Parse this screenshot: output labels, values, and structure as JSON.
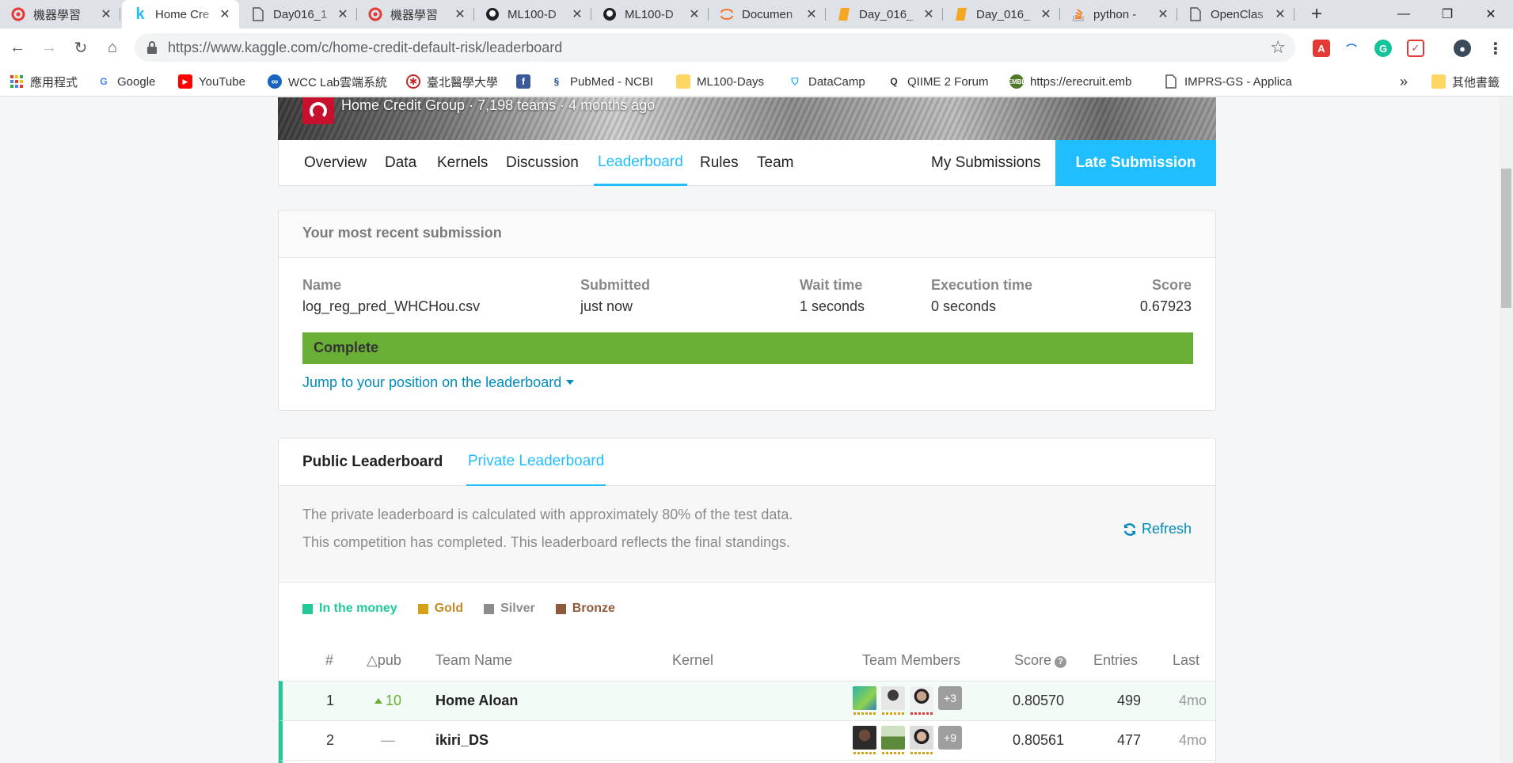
{
  "browser": {
    "tabs": [
      {
        "title": "機器學習",
        "icon": "red-swirl-icon",
        "active": false
      },
      {
        "title": "Home Cre",
        "icon": "kaggle-k-icon",
        "active": true
      },
      {
        "title": "Day016_1",
        "icon": "document-icon",
        "active": false
      },
      {
        "title": "機器學習",
        "icon": "red-swirl-icon",
        "active": false
      },
      {
        "title": "ML100-D",
        "icon": "github-icon",
        "active": false
      },
      {
        "title": "ML100-D",
        "icon": "github-icon",
        "active": false
      },
      {
        "title": "Documen",
        "icon": "jupyter-icon",
        "active": false
      },
      {
        "title": "Day_016_",
        "icon": "orange-book-icon",
        "active": false
      },
      {
        "title": "Day_016_",
        "icon": "orange-book-icon",
        "active": false
      },
      {
        "title": "python -",
        "icon": "stackoverflow-icon",
        "active": false
      },
      {
        "title": "OpenClas",
        "icon": "document-icon",
        "active": false
      }
    ],
    "url_host": "https://www.kaggle.com",
    "url_path": "/c/home-credit-default-risk/leaderboard",
    "bookmarks": [
      {
        "label": "應用程式",
        "icon": "apps-grid-icon"
      },
      {
        "label": "Google",
        "icon": "google-icon"
      },
      {
        "label": "YouTube",
        "icon": "youtube-icon"
      },
      {
        "label": "WCC Lab雲端系統",
        "icon": "cloud-icon"
      },
      {
        "label": "臺北醫學大學",
        "icon": "university-icon"
      },
      {
        "label": "",
        "icon": "facebook-icon"
      },
      {
        "label": "PubMed - NCBI",
        "icon": "pubmed-icon"
      },
      {
        "label": "ML100-Days",
        "icon": "folder-icon"
      },
      {
        "label": "DataCamp",
        "icon": "datacamp-icon"
      },
      {
        "label": "QIIME 2 Forum",
        "icon": "qiime-icon"
      },
      {
        "label": "https://erecruit.emb",
        "icon": "embl-icon"
      },
      {
        "label": "IMPRS-GS - Applica",
        "icon": "document-icon"
      },
      {
        "label": "其他書籤",
        "icon": "folder-icon"
      }
    ],
    "overflow_label": "»"
  },
  "competition": {
    "host": "Home Credit Group",
    "teams": "7,198 teams",
    "ago": "4 months ago",
    "nav": [
      "Overview",
      "Data",
      "Kernels",
      "Discussion",
      "Leaderboard",
      "Rules",
      "Team"
    ],
    "my_submissions": "My Submissions",
    "late_submission": "Late Submission"
  },
  "recent": {
    "header": "Your most recent submission",
    "labels": {
      "name": "Name",
      "submitted": "Submitted",
      "wait": "Wait time",
      "exec": "Execution time",
      "score": "Score"
    },
    "values": {
      "name": "log_reg_pred_WHCHou.csv",
      "submitted": "just now",
      "wait": "1 seconds",
      "exec": "0 seconds",
      "score": "0.67923"
    },
    "status": "Complete",
    "jump": "Jump to your position on the leaderboard"
  },
  "leaderboard": {
    "tabs": [
      "Public Leaderboard",
      "Private Leaderboard"
    ],
    "info1": "The private leaderboard is calculated with approximately 80% of the test data.",
    "info2": "This competition has completed. This leaderboard reflects the final standings.",
    "refresh": "Refresh",
    "legend": [
      {
        "label": "In the money",
        "color": "#20c997"
      },
      {
        "label": "Gold",
        "color": "#d4a017"
      },
      {
        "label": "Silver",
        "color": "#8c8c8c"
      },
      {
        "label": "Bronze",
        "color": "#8d5a3b"
      }
    ],
    "columns": {
      "rank": "#",
      "delta": "△pub",
      "team": "Team Name",
      "kernel": "Kernel",
      "members": "Team Members",
      "score": "Score",
      "help": "?",
      "entries": "Entries",
      "last": "Last"
    },
    "rows": [
      {
        "rank": "1",
        "delta": "10",
        "team": "Home Aloan",
        "more": "+3",
        "score": "0.80570",
        "entries": "499",
        "last": "4mo"
      },
      {
        "rank": "2",
        "delta": "—",
        "team": "ikiri_DS",
        "more": "+9",
        "score": "0.80561",
        "entries": "477",
        "last": "4mo"
      }
    ]
  }
}
